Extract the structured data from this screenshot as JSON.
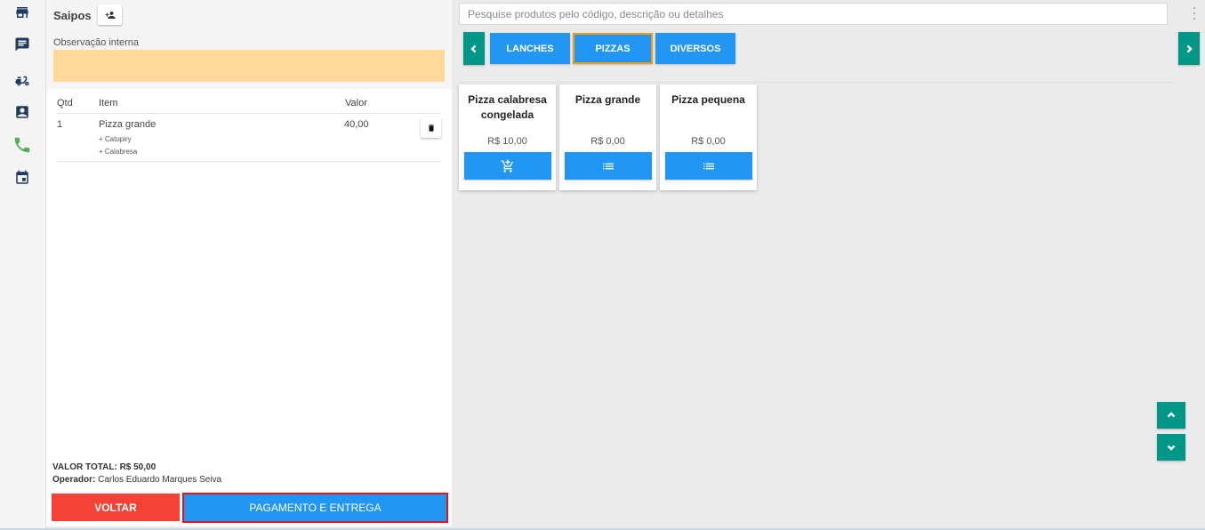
{
  "rail": {
    "icons": [
      "store-icon",
      "chat-icon",
      "delivery-scooter-icon",
      "contact-card-icon",
      "phone-icon",
      "calendar-icon"
    ],
    "phone_color": "#4caf50",
    "icon_color": "#1f3a5f"
  },
  "order": {
    "customer_name": "Saipos",
    "obs_label": "Observação interna",
    "obs_value": "",
    "obs_color": "#ffd89c",
    "columns": {
      "qty": "Qtd",
      "item": "Item",
      "value": "Valor"
    },
    "items": [
      {
        "qty": "1",
        "name": "Pizza grande",
        "extras": [
          "+ Catupiry",
          "+ Calabresa"
        ],
        "value": "40,00"
      }
    ],
    "total_label": "VALOR TOTAL:",
    "total_value": "R$ 50,00",
    "operator_label": "Operador:",
    "operator_name": "Carlos Eduardo Marques Seiva",
    "back_label": "VOLTAR",
    "pay_label": "PAGAMENTO E ENTREGA",
    "colors": {
      "back": "#f44336",
      "pay": "#2196f3",
      "pay_border": "#e8131a"
    }
  },
  "products": {
    "search_placeholder": "Pesquise produtos pelo código, descrição ou detalhes",
    "categories": [
      {
        "label": "LANCHES",
        "active": false
      },
      {
        "label": "PIZZAS",
        "active": true
      },
      {
        "label": "DIVERSOS",
        "active": false
      }
    ],
    "cards": [
      {
        "name": "Pizza calabresa congelada",
        "price": "R$ 10,00",
        "action_icon": "add-to-cart-icon"
      },
      {
        "name": "Pizza grande",
        "price": "R$ 0,00",
        "action_icon": "list-icon"
      },
      {
        "name": "Pizza pequena",
        "price": "R$ 0,00",
        "action_icon": "list-icon"
      }
    ],
    "colors": {
      "accent": "#2196f3",
      "nav": "#009688",
      "active_border": "#f39c12"
    }
  }
}
